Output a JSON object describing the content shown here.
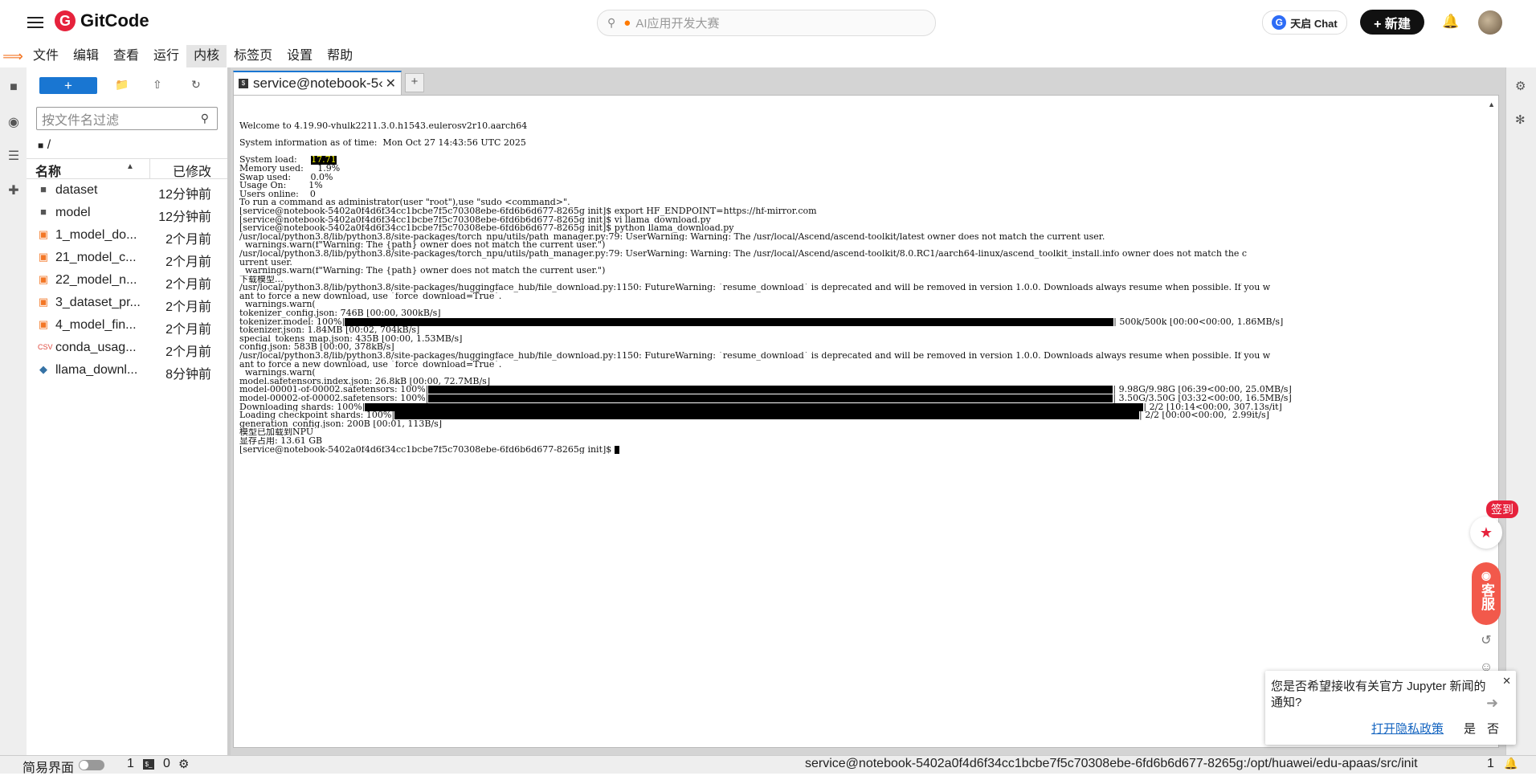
{
  "header": {
    "brand": "GitCode",
    "search_placeholder": "AI应用开发大赛",
    "chat_label": "天启 Chat",
    "new_label": "+ 新建"
  },
  "menubar": [
    "文件",
    "编辑",
    "查看",
    "运行",
    "内核",
    "标签页",
    "设置",
    "帮助"
  ],
  "menubar_active": "内核",
  "filebrowser": {
    "new_label": "+",
    "filter_placeholder": "按文件名过滤",
    "breadcrumb": "/",
    "col_name": "名称",
    "col_modified": "已修改",
    "files": [
      {
        "name": "dataset",
        "time": "12分钟前",
        "type": "folder"
      },
      {
        "name": "model",
        "time": "12分钟前",
        "type": "folder"
      },
      {
        "name": "1_model_do...",
        "time": "2个月前",
        "type": "notebook"
      },
      {
        "name": "21_model_c...",
        "time": "2个月前",
        "type": "notebook"
      },
      {
        "name": "22_model_n...",
        "time": "2个月前",
        "type": "notebook"
      },
      {
        "name": "3_dataset_pr...",
        "time": "2个月前",
        "type": "notebook"
      },
      {
        "name": "4_model_fin...",
        "time": "2个月前",
        "type": "notebook"
      },
      {
        "name": "conda_usag...",
        "time": "2个月前",
        "type": "csv"
      },
      {
        "name": "llama_downl...",
        "time": "8分钟前",
        "type": "python"
      }
    ]
  },
  "tab": {
    "label": "service@notebook-5‹"
  },
  "terminal": {
    "lines": [
      {
        "text": "Welcome to 4.19.90-vhulk2211.3.0.h1543.eulerosv2r10.aarch64"
      },
      {
        "text": ""
      },
      {
        "text": "System information as of time:  Mon Oct 27 14:43:56 UTC 2025"
      },
      {
        "text": ""
      },
      {
        "text": "System load:     ",
        "hl": "17.71"
      },
      {
        "text": "Memory used:     1.9%"
      },
      {
        "text": "Swap used:       0.0%"
      },
      {
        "text": "Usage On:        1%"
      },
      {
        "text": "Users online:    0"
      },
      {
        "text": "To run a command as administrator(user \"root\"),use \"sudo <command>\"."
      },
      {
        "text": "[service@notebook-5402a0f4d6f34cc1bcbe7f5c70308ebe-6fd6b6d677-8265g init]$ export HF_ENDPOINT=https://hf-mirror.com"
      },
      {
        "text": "[service@notebook-5402a0f4d6f34cc1bcbe7f5c70308ebe-6fd6b6d677-8265g init]$ vi llama_download.py"
      },
      {
        "text": "[service@notebook-5402a0f4d6f34cc1bcbe7f5c70308ebe-6fd6b6d677-8265g init]$ python llama_download.py"
      },
      {
        "text": "/usr/local/python3.8/lib/python3.8/site-packages/torch_npu/utils/path_manager.py:79: UserWarning: Warning: The /usr/local/Ascend/ascend-toolkit/latest owner does not match the current user."
      },
      {
        "text": "  warnings.warn(f\"Warning: The {path} owner does not match the current user.\")"
      },
      {
        "text": "/usr/local/python3.8/lib/python3.8/site-packages/torch_npu/utils/path_manager.py:79: UserWarning: Warning: The /usr/local/Ascend/ascend-toolkit/8.0.RC1/aarch64-linux/ascend_toolkit_install.info owner does not match the c"
      },
      {
        "text": "urrent user."
      },
      {
        "text": "  warnings.warn(f\"Warning: The {path} owner does not match the current user.\")"
      },
      {
        "text": "下载模型..."
      },
      {
        "text": "/usr/local/python3.8/lib/python3.8/site-packages/huggingface_hub/file_download.py:1150: FutureWarning: `resume_download` is deprecated and will be removed in version 1.0.0. Downloads always resume when possible. If you w"
      },
      {
        "text": "ant to force a new download, use `force_download=True`."
      },
      {
        "text": "  warnings.warn("
      },
      {
        "text": "tokenizer_config.json: 746B [00:00, 300kB/s]"
      },
      {
        "text": "tokenizer.model: 100%|",
        "bar": 0.736,
        "after": "| 500k/500k [00:00<00:00, 1.86MB/s]"
      },
      {
        "text": "tokenizer.json: 1.84MB [00:02, 704kB/s]"
      },
      {
        "text": "special_tokens_map.json: 435B [00:00, 1.53MB/s]"
      },
      {
        "text": "config.json: 583B [00:00, 378kB/s]"
      },
      {
        "text": "/usr/local/python3.8/lib/python3.8/site-packages/huggingface_hub/file_download.py:1150: FutureWarning: `resume_download` is deprecated and will be removed in version 1.0.0. Downloads always resume when possible. If you w"
      },
      {
        "text": "ant to force a new download, use `force_download=True`."
      },
      {
        "text": "  warnings.warn("
      },
      {
        "text": "model.safetensors.index.json: 26.8kB [00:00, 72.7MB/s]"
      },
      {
        "text": "model-00001-of-00002.safetensors: 100%|",
        "bar": 0.655,
        "after": "| 9.98G/9.98G [06:39<00:00, 25.0MB/s]"
      },
      {
        "text": "model-00002-of-00002.safetensors: 100%|",
        "bar": 0.655,
        "after": "| 3.50G/3.50G [03:32<00:00, 16.5MB/s]"
      },
      {
        "text": "Downloading shards: 100%|",
        "bar": 0.745,
        "after": "| 2/2 [10:14<00:00, 307.13s/it]"
      },
      {
        "text": "Loading checkpoint shards: 100%|",
        "bar": 0.713,
        "after": "| 2/2 [00:00<00:00,  2.99it/s]"
      },
      {
        "text": "generation_config.json: 200B [00:01, 113B/s]"
      },
      {
        "text": "模型已加载到NPU"
      },
      {
        "text": "显存占用: 13.61 GB"
      },
      {
        "text": "[service@notebook-5402a0f4d6f34cc1bcbe7f5c70308ebe-6fd6b6d677-8265g init]$ ",
        "cursor": true
      }
    ]
  },
  "floating": {
    "sign_label": "签到",
    "cs_label": "客服"
  },
  "notification": {
    "message": "您是否希望接收有关官方 Jupyter 新闻的通知?",
    "privacy_link": "打开隐私政策",
    "yes": "是",
    "no": "否"
  },
  "statusbar": {
    "simple_label": "简易界面",
    "terminals_count": "1",
    "kernels_count": "0",
    "path": "service@notebook-5402a0f4d6f34cc1bcbe7f5c70308ebe-6fd6b6d677-8265g:/opt/huawei/edu-apaas/src/init",
    "line": "1"
  }
}
